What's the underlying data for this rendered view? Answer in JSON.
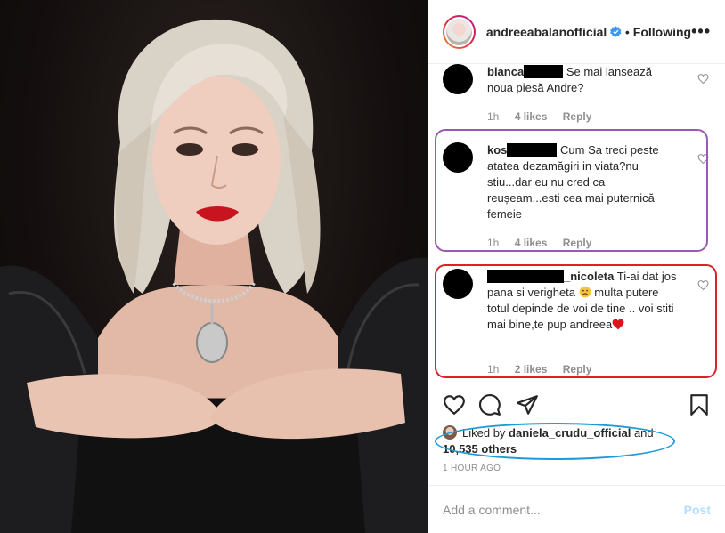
{
  "header": {
    "username": "andreeabalanofficial",
    "separator": "•",
    "follow_status": "Following",
    "more_label": "•••"
  },
  "comments": [
    {
      "user": "bianca",
      "text": "Se mai lansează noua piesă Andre?",
      "time": "1h",
      "likes": "4 likes",
      "reply": "Reply"
    },
    {
      "user": "kos",
      "text": "Cum Sa treci peste atatea dezamăgiri in viata?nu stiu...dar eu nu cred ca reușeam...esti cea mai puternică femeie",
      "time": "1h",
      "likes": "4 likes",
      "reply": "Reply"
    },
    {
      "user": "_nicoleta",
      "text": "Ti-ai dat jos pana si verigheta",
      "text_2": "multa putere totul depinde de voi de tine .. voi stiti mai bine,te pup andreea",
      "time": "1h",
      "likes": "2 likes",
      "reply": "Reply"
    }
  ],
  "likes": {
    "prefix": "Liked by",
    "user": "daniela_crudu_official",
    "and": "and",
    "others": "10,535 others"
  },
  "timestamp": "1 HOUR AGO",
  "add_comment": {
    "placeholder": "Add a comment...",
    "post_label": "Post"
  },
  "colors": {
    "highlight_purple": "#9b59b6",
    "highlight_red": "#d8232a",
    "highlight_blue": "#1e9bd7",
    "verified": "#3897f0",
    "post_disabled": "#b2dffc"
  },
  "icons": [
    "heart-icon",
    "comment-icon",
    "share-icon",
    "bookmark-icon",
    "verified-icon",
    "more-icon",
    "sad-emoji-icon",
    "red-heart-emoji-icon"
  ]
}
